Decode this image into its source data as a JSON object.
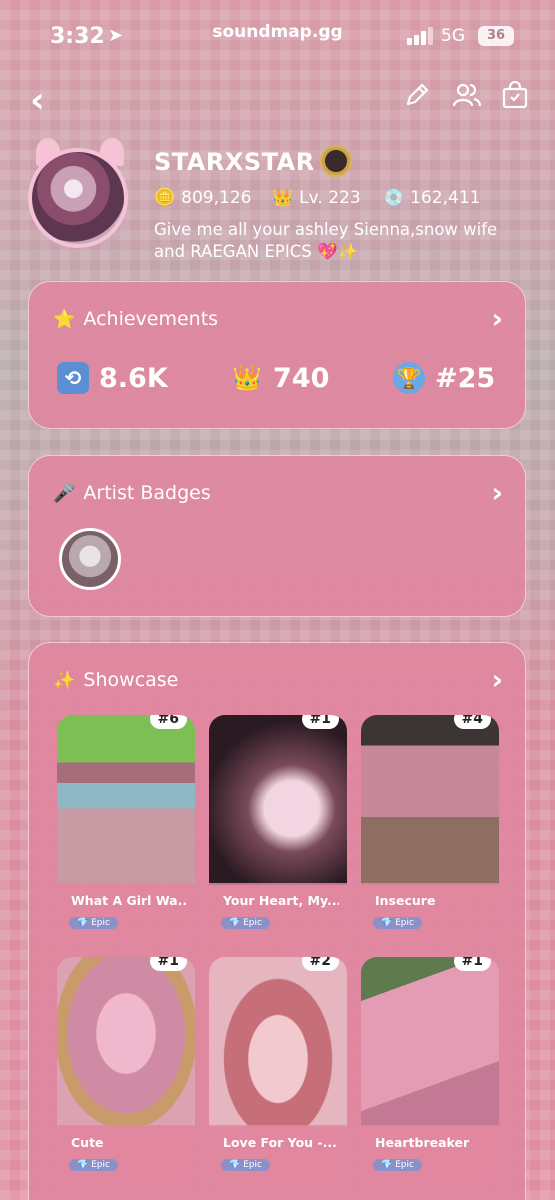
{
  "status_bar": {
    "time": "3:32",
    "url": "soundmap.gg",
    "network": "5G",
    "battery": "36"
  },
  "nav": {
    "back_icon": "chevron-left-icon",
    "edit_icon": "pencil-icon",
    "friends_icon": "users-icon",
    "shop_icon": "shopping-bag-icon"
  },
  "profile": {
    "username": "STARXSTAR",
    "coins": "809,126",
    "level": "Lv. 223",
    "discs": "162,411",
    "bio": "Give me all your ashley Sienna,snow wife and RAEGAN EPICS 💖✨"
  },
  "achievements": {
    "title": "Achievements",
    "title_icon": "⭐",
    "repeats": "8.6K",
    "crowns": "740",
    "rank": "#25"
  },
  "artist_badges": {
    "title": "Artist Badges",
    "title_icon": "🎤"
  },
  "showcase": {
    "title": "Showcase",
    "title_icon": "✨",
    "tiles": [
      {
        "rank": "#6",
        "name": "What A Girl Wa...",
        "rarity": "💎 Epic"
      },
      {
        "rank": "#1",
        "name": "Your Heart, My...",
        "rarity": "💎 Epic"
      },
      {
        "rank": "#4",
        "name": "Insecure",
        "rarity": "💎 Epic"
      },
      {
        "rank": "#1",
        "name": "Cute",
        "rarity": "💎 Epic"
      },
      {
        "rank": "#2",
        "name": "Love For You -...",
        "rarity": "💎 Epic"
      },
      {
        "rank": "#1",
        "name": "Heartbreaker",
        "rarity": "💎 Epic"
      }
    ]
  },
  "colors": {
    "card": "#e087a0",
    "epic_pill": "#8c90c9",
    "repeat_box": "#5b8fd4",
    "rank_box": "#6aa7e6"
  }
}
